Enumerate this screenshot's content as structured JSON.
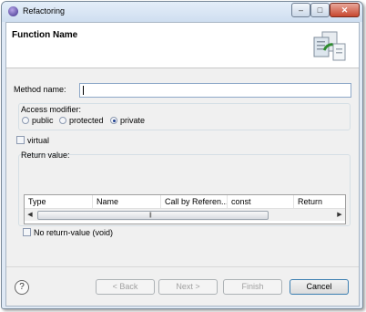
{
  "window": {
    "title": "Refactoring",
    "min_glyph": "–",
    "max_glyph": "□",
    "close_glyph": "✕"
  },
  "header": {
    "page_title": "Function Name"
  },
  "form": {
    "method_name_label": "Method name:",
    "method_name_value": "",
    "access": {
      "label": "Access modifier:",
      "options": [
        "public",
        "protected",
        "private"
      ],
      "selected": "private"
    },
    "virtual_label": "virtual",
    "virtual_checked": false,
    "return_value": {
      "label": "Return value:",
      "columns": [
        "Type",
        "Name",
        "Call by Referen...",
        "const",
        "Return"
      ],
      "rows": []
    },
    "no_return_label": "No return-value (void)",
    "no_return_checked": false
  },
  "footer": {
    "help_glyph": "?",
    "back_label": "< Back",
    "next_label": "Next >",
    "finish_label": "Finish",
    "cancel_label": "Cancel"
  }
}
